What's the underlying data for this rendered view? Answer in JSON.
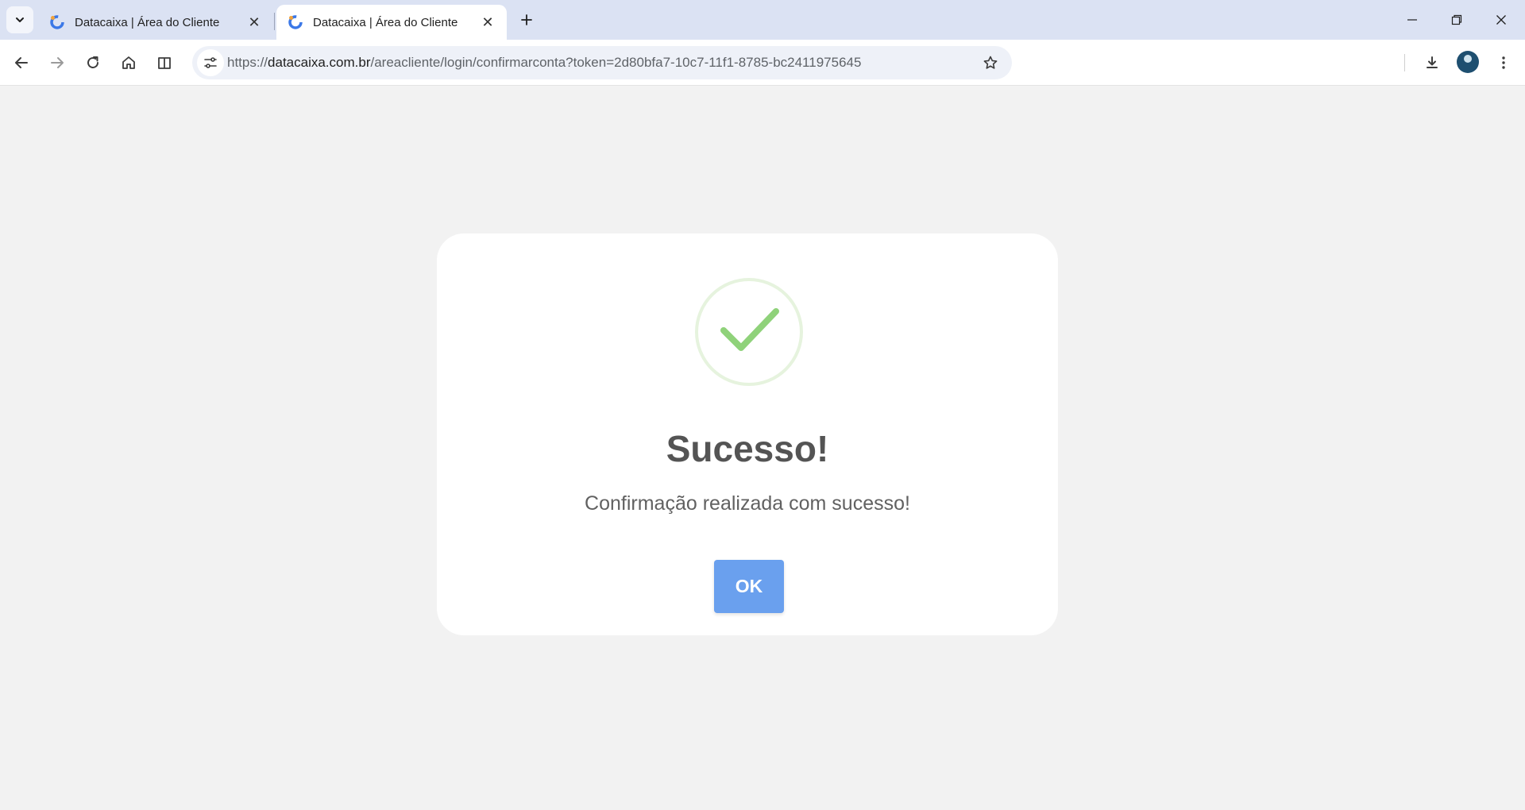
{
  "browser": {
    "tabs": [
      {
        "title": "Datacaixa | Área do Cliente",
        "active": false
      },
      {
        "title": "Datacaixa | Área do Cliente",
        "active": true
      }
    ],
    "url": {
      "scheme": "https://",
      "host": "datacaixa.com.br",
      "path": "/areacliente/login/confirmarconta?token=2d80bfa7-10c7-11f1-8785-bc2411975645"
    },
    "icons": {
      "tab_search": "chevron-down-icon",
      "tab_close": "close-icon",
      "new_tab": "plus-icon",
      "back": "arrow-left-icon",
      "forward": "arrow-right-icon",
      "reload": "reload-icon",
      "home": "home-icon",
      "split": "split-view-icon",
      "site_info": "tune-icon",
      "bookmark": "star-icon",
      "download": "download-icon",
      "menu": "kebab-menu-icon"
    }
  },
  "modal": {
    "title": "Sucesso!",
    "message": "Confirmação realizada com sucesso!",
    "ok_label": "OK",
    "colors": {
      "button": "#6aa0ee",
      "check": "#8fd27a",
      "ring": "#e6f3de",
      "title": "#545454"
    }
  }
}
